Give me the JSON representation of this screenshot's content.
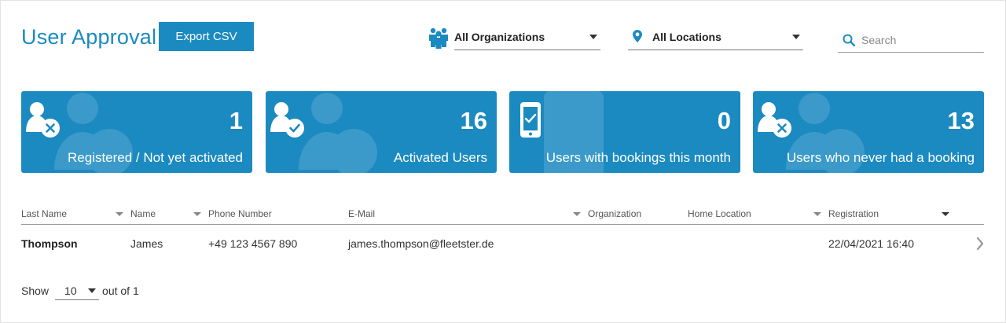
{
  "header": {
    "title": "User Approval",
    "export_label": "Export CSV"
  },
  "filters": {
    "organization": "All Organizations",
    "location": "All Locations",
    "search_placeholder": "Search"
  },
  "cards": [
    {
      "value": "1",
      "label": "Registered / Not yet activated",
      "icon": "user-x-icon"
    },
    {
      "value": "16",
      "label": "Activated Users",
      "icon": "user-check-icon"
    },
    {
      "value": "0",
      "label": "Users with bookings this month",
      "icon": "phone-check-icon"
    },
    {
      "value": "13",
      "label": "Users who never had a booking",
      "icon": "user-x-icon"
    }
  ],
  "table": {
    "columns": [
      "Last Name",
      "Name",
      "Phone Number",
      "E-Mail",
      "Organization",
      "Home Location",
      "Registration"
    ],
    "rows": [
      {
        "last_name": "Thompson",
        "name": "James",
        "phone": "+49 123 4567 890",
        "email": "james.thompson@fleetster.de",
        "organization": "",
        "home_location": "",
        "registration": "22/04/2021 16:40"
      }
    ]
  },
  "pager": {
    "show_label": "Show",
    "page_size": "10",
    "out_of_label": "out of 1"
  },
  "colors": {
    "accent": "#1b8ac0"
  }
}
